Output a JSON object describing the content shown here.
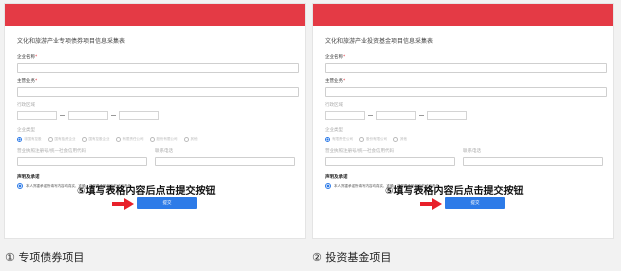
{
  "panels": [
    {
      "form_title": "文化和旅游产业专项债券项目信息采集表",
      "company_name_label": "企业名称",
      "main_business_label": "主营业务",
      "region_label": "行政区域",
      "company_type_label": "企业类型",
      "company_type_options": [
        "非国有控股",
        "国有独资企业",
        "国有控股企业",
        "有限责任公司",
        "股份有限公司",
        "其他"
      ],
      "company_type_selected": 0,
      "credit_code_label": "营业执照注册号/统一社会信用代码",
      "contact_label": "联系电话",
      "declaration_title": "声明及承诺",
      "declaration_text": "本人郑重承诺所填写内容均真实、准确，并愿意承担相应的法律责任。",
      "instruction": "⑤填写表格内容后点击提交按钮",
      "submit_label": "提交"
    },
    {
      "form_title": "文化和旅游产业投资基金项目信息采集表",
      "company_name_label": "企业名称",
      "main_business_label": "主营业务",
      "region_label": "行政区域",
      "company_type_label": "企业类型",
      "company_type_options": [
        "有限责任公司",
        "股份有限公司",
        "其他"
      ],
      "company_type_selected": 0,
      "credit_code_label": "营业执照注册号/统一社会信用代码",
      "contact_label": "联系电话",
      "declaration_title": "声明及承诺",
      "declaration_text": "本人郑重承诺所填写内容均真实、准确，并愿意承担相应的法律责任。",
      "instruction": "⑤填写表格内容后点击提交按钮",
      "submit_label": "提交"
    }
  ],
  "captions": {
    "left": "① 专项债券项目",
    "right": "② 投资基金项目"
  },
  "colors": {
    "header_red": "#e43a45",
    "primary_blue": "#2d7be8",
    "arrow_red": "#e8202a"
  }
}
